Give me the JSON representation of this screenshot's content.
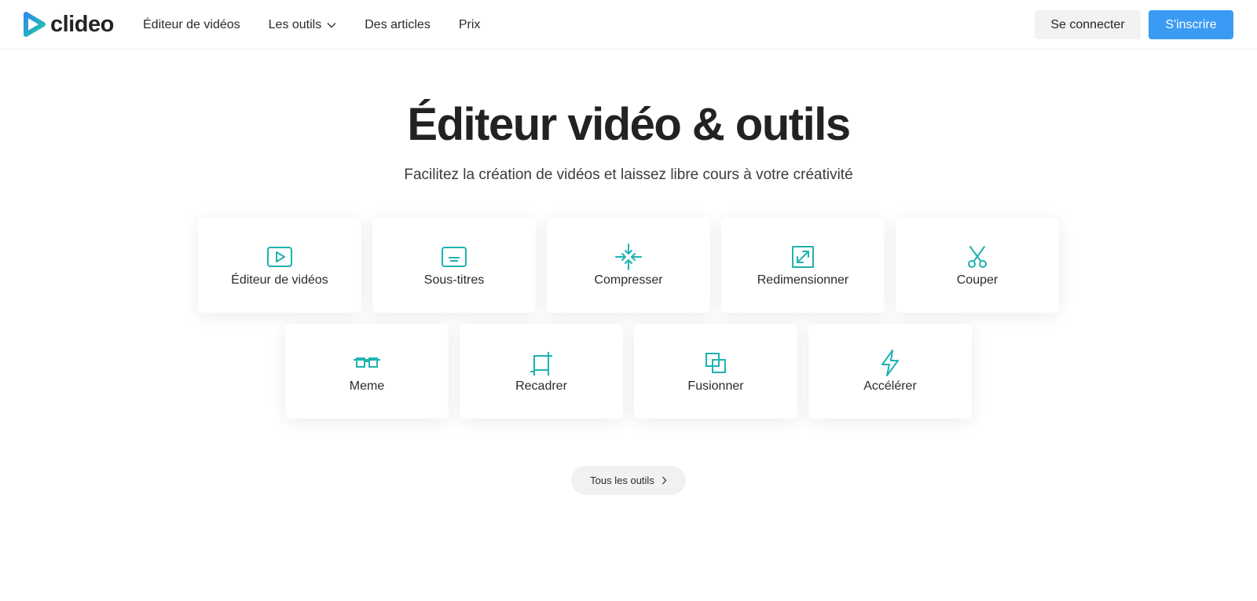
{
  "header": {
    "logo_text": "clideo",
    "nav": [
      {
        "label": "Éditeur de vidéos"
      },
      {
        "label": "Les outils"
      },
      {
        "label": "Des articles"
      },
      {
        "label": "Prix"
      }
    ],
    "login_label": "Se connecter",
    "signup_label": "S'inscrire"
  },
  "hero": {
    "title": "Éditeur vidéo & outils",
    "subtitle": "Facilitez la création de vidéos et laissez libre cours à votre créativité"
  },
  "tools": [
    {
      "label": "Éditeur de vidéos",
      "icon": "play-screen-icon"
    },
    {
      "label": "Sous-titres",
      "icon": "subtitles-icon"
    },
    {
      "label": "Compresser",
      "icon": "compress-icon"
    },
    {
      "label": "Redimensionner",
      "icon": "resize-icon"
    },
    {
      "label": "Couper",
      "icon": "scissors-icon"
    },
    {
      "label": "Meme",
      "icon": "meme-glasses-icon"
    },
    {
      "label": "Recadrer",
      "icon": "crop-icon"
    },
    {
      "label": "Fusionner",
      "icon": "merge-icon"
    },
    {
      "label": "Accélérer",
      "icon": "lightning-icon"
    }
  ],
  "all_tools_label": "Tous les outils",
  "colors": {
    "accent": "#1fb2b0",
    "primary_button": "#3a9bf4",
    "secondary_button": "#f2f2f2"
  }
}
